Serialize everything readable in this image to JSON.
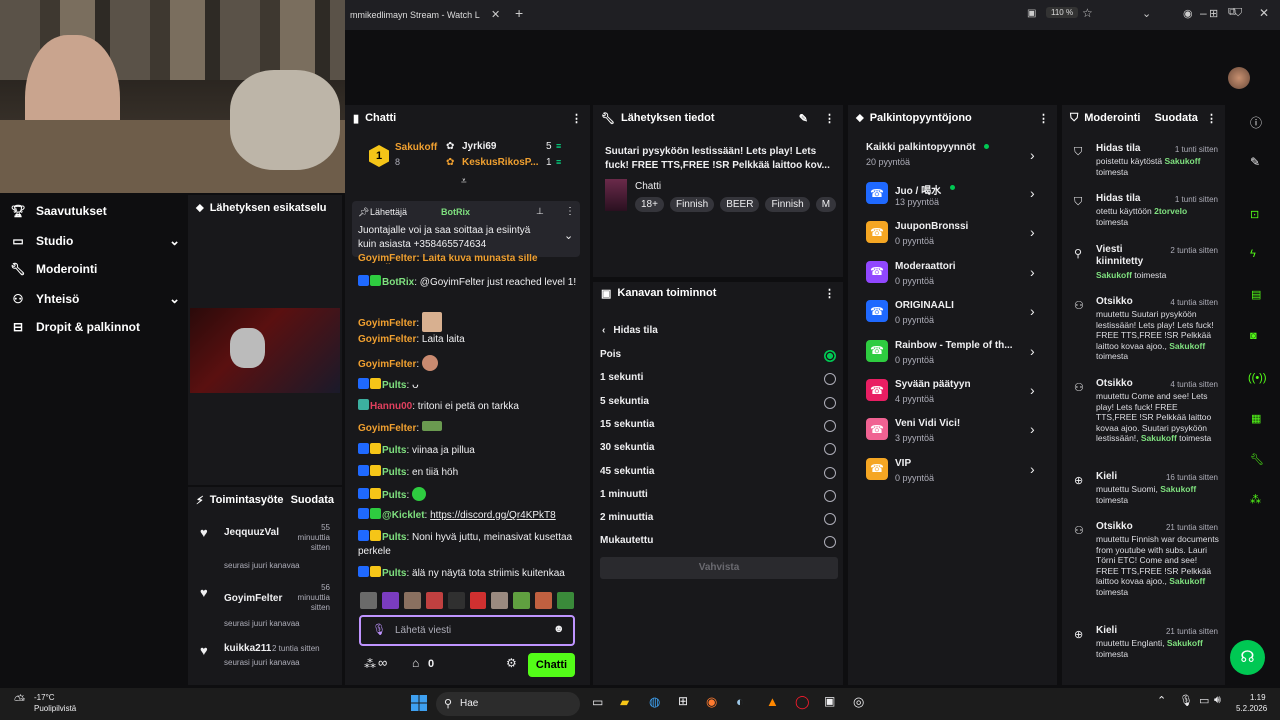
{
  "browser": {
    "tab_title": "mmikedlimayn Stream - Watch L",
    "zoom": "110 %"
  },
  "sidebar": {
    "items": [
      {
        "label": "Saavutukset",
        "icon": "trophy-icon"
      },
      {
        "label": "Studio",
        "icon": "studio-icon",
        "chevron": true
      },
      {
        "label": "Moderointi",
        "icon": "wrench-icon"
      },
      {
        "label": "Yhteisö",
        "icon": "community-icon",
        "chevron": true
      },
      {
        "label": "Dropit & palkinnot",
        "icon": "drops-icon"
      }
    ]
  },
  "preview": {
    "title": "Lähetyksen esikatselu"
  },
  "activity": {
    "title": "Toimintasyöte",
    "filter": "Suodata",
    "items": [
      {
        "name": "JeqquuzVal",
        "time": "55 minuuttia sitten",
        "desc": "seurasi juuri kanavaa"
      },
      {
        "name": "GoyimFelter",
        "time": "56 minuuttia sitten",
        "desc": "seurasi juuri kanavaa"
      },
      {
        "name": "kuikka211",
        "time": "2 tuntia sitten",
        "desc": "seurasi juuri kanavaa"
      }
    ]
  },
  "chat": {
    "title": "Chatti",
    "leaderboard": {
      "rank": "1",
      "first_name": "Sakukoff",
      "first_score": "5",
      "first_sub": "8",
      "second_name": "Jyrki69",
      "third_name": "KeskusRikosP...",
      "third_score": "1"
    },
    "pinned": {
      "by_label": "Lähettäjä",
      "by_user": "BotRix",
      "text": "Juontajalle voi ja saa soittaa ja esiintyä kuin asiasta +358465574634"
    },
    "cut_line": "GoyimFelter: Laita kuva munasta sille nomolle",
    "messages": [
      {
        "user": "BotRix",
        "color": "#7fe07f",
        "text": "@GoyimFelter just reached level 1!"
      },
      {
        "user": "GoyimFelter",
        "color": "#f0a030",
        "text": ""
      },
      {
        "user": "GoyimFelter",
        "color": "#f0a030",
        "text": "Laita laita"
      },
      {
        "user": "GoyimFelter",
        "color": "#f0a030",
        "text": ""
      },
      {
        "user": "Pults",
        "color": "#7fe07f",
        "text": ""
      },
      {
        "user": "Hannu00",
        "color": "#e0405e",
        "text": "tritoni ei petä on tarkka"
      },
      {
        "user": "GoyimFelter",
        "color": "#f0a030",
        "text": ""
      },
      {
        "user": "Pults",
        "color": "#7fe07f",
        "text": "viinaa ja pillua"
      },
      {
        "user": "Pults",
        "color": "#7fe07f",
        "text": "en tiiä   höh"
      },
      {
        "user": "Pults",
        "color": "#7fe07f",
        "text": ""
      },
      {
        "user": "@Kicklet",
        "color": "#7fe07f",
        "text": "https://discord.gg/Qr4KPkT8"
      },
      {
        "user": "Pults",
        "color": "#7fe07f",
        "text": "Noni hyvä juttu, meinasivat kusettaa perkele"
      },
      {
        "user": "Pults",
        "color": "#7fe07f",
        "text": "älä ny näytä tota striimis kuitenkaa"
      }
    ],
    "input_placeholder": "Lähetä viesti",
    "points": "0",
    "send_label": "Chatti"
  },
  "stream_info": {
    "title": "Lähetyksen tiedot",
    "headline": "Suutari pysyköön lestissään! Lets play! Lets fuck! FREE TTS,FREE !SR Pelkkää laittoo kov...",
    "category": "Chatti",
    "tags": [
      "18+",
      "Finnish",
      "BEER",
      "Finnish",
      "M"
    ]
  },
  "channel_actions": {
    "title": "Kanavan toiminnot",
    "back_label": "Hidas tila",
    "options": [
      "Pois",
      "1 sekunti",
      "5 sekuntia",
      "15 sekuntia",
      "30 sekuntia",
      "45 sekuntia",
      "1 minuutti",
      "2 minuuttia",
      "Mukautettu"
    ],
    "selected": 0,
    "confirm": "Vahvista"
  },
  "rewards": {
    "title": "Palkintopyyntöjono",
    "all_label": "Kaikki palkintopyynnöt",
    "all_count": "20 pyyntöä",
    "items": [
      {
        "name": "Juo / 喝水",
        "count": "13 pyyntöä",
        "color": "#1f69ff",
        "live": true
      },
      {
        "name": "JuuponBronssi",
        "count": "0 pyyntöä",
        "color": "#f5a623"
      },
      {
        "name": "Moderaattori",
        "count": "0 pyyntöä",
        "color": "#9147ff"
      },
      {
        "name": "ORIGINAALI",
        "count": "0 pyyntöä",
        "color": "#1f69ff"
      },
      {
        "name": "Rainbow - Temple of th...",
        "count": "0 pyyntöä",
        "color": "#2ecc40"
      },
      {
        "name": "Syvään päätyyn",
        "count": "4 pyyntöä",
        "color": "#e91e63"
      },
      {
        "name": "Veni Vidi Vici!",
        "count": "3 pyyntöä",
        "color": "#f06292"
      },
      {
        "name": "VIP",
        "count": "0 pyyntöä",
        "color": "#f5a623"
      }
    ]
  },
  "moderation": {
    "title": "Moderointi",
    "filter": "Suodata",
    "entries": [
      {
        "icon": "shield-icon",
        "title": "Hidas tila",
        "time": "1 tunti sitten",
        "body": "poistettu käytöstä",
        "actor": "Sakukoff",
        "tail": "toimesta"
      },
      {
        "icon": "shield-icon",
        "title": "Hidas tila",
        "time": "1 tunti sitten",
        "body": "otettu käyttöön",
        "actor": "2torvelo",
        "tail": "toimesta"
      },
      {
        "icon": "pin-icon",
        "title": "Viesti kiinnitetty",
        "time": "2 tuntia sitten",
        "body": "",
        "actor": "Sakukoff",
        "tail": "toimesta"
      },
      {
        "icon": "people-icon",
        "title": "Otsikko",
        "time": "4 tuntia sitten",
        "body": "muutettu Suutari pysyköön lestissään! Lets play! Lets fuck! FREE TTS,FREE !SR Pelkkää laittoo kovaa ajoo.,",
        "actor": "Sakukoff",
        "tail": "toimesta"
      },
      {
        "icon": "people-icon",
        "title": "Otsikko",
        "time": "4 tuntia sitten",
        "body": "muutettu Come and see! Lets play! Lets fuck! FREE TTS,FREE !SR Pelkkää laittoo kovaa ajoo. Suutari pysyköön lestissään!,",
        "actor": "Sakukoff",
        "tail": "toimesta"
      },
      {
        "icon": "globe-icon",
        "title": "Kieli",
        "time": "16 tuntia sitten",
        "body": "muutettu Suomi,",
        "actor": "Sakukoff",
        "tail": "toimesta"
      },
      {
        "icon": "people-icon",
        "title": "Otsikko",
        "time": "21 tuntia sitten",
        "body": "muutettu Finnish war documents from youtube with subs. Lauri Törni ETC! Come and see! FREE TTS,FREE !SR Pelkkää laittoo kovaa ajoo.,",
        "actor": "Sakukoff",
        "tail": "toimesta"
      },
      {
        "icon": "globe-icon",
        "title": "Kieli",
        "time": "21 tuntia sitten",
        "body": "muutettu Englanti,",
        "actor": "Sakukoff",
        "tail": "toimesta"
      }
    ]
  },
  "taskbar": {
    "weather_temp": "-17°C",
    "weather_desc": "Puolipilvistä",
    "search": "Hae",
    "time": "1.19",
    "date": "5.2.2026"
  },
  "colors": {
    "accent": "#53fc18",
    "bg": "#0e0e10",
    "panel": "#18181b",
    "green": "#00c853"
  }
}
